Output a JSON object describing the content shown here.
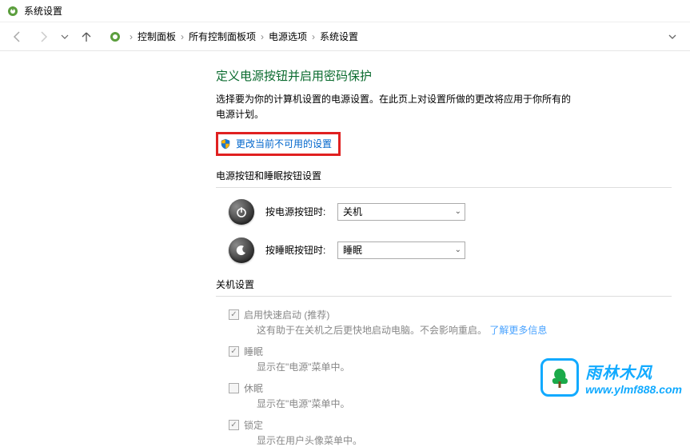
{
  "titlebar": {
    "title": "系统设置"
  },
  "breadcrumb": {
    "items": [
      "控制面板",
      "所有控制面板项",
      "电源选项",
      "系统设置"
    ]
  },
  "page": {
    "title": "定义电源按钮并启用密码保护",
    "desc": "选择要为你的计算机设置的电源设置。在此页上对设置所做的更改将应用于你所有的电源计划。",
    "change_link": "更改当前不可用的设置"
  },
  "power_section": {
    "title": "电源按钮和睡眠按钮设置",
    "rows": [
      {
        "label": "按电源按钮时:",
        "value": "关机"
      },
      {
        "label": "按睡眠按钮时:",
        "value": "睡眠"
      }
    ]
  },
  "shutdown_section": {
    "title": "关机设置",
    "items": [
      {
        "label": "启用快速启动 (推荐)",
        "checked": true,
        "desc_pre": "这有助于在关机之后更快地启动电脑。不会影响重启。",
        "link": "了解更多信息"
      },
      {
        "label": "睡眠",
        "checked": true,
        "desc": "显示在\"电源\"菜单中。"
      },
      {
        "label": "休眠",
        "checked": false,
        "desc": "显示在\"电源\"菜单中。"
      },
      {
        "label": "锁定",
        "checked": true,
        "desc": "显示在用户头像菜单中。"
      }
    ]
  },
  "watermark": {
    "cn": "雨林木风",
    "url": "www.ylmf888.com"
  }
}
